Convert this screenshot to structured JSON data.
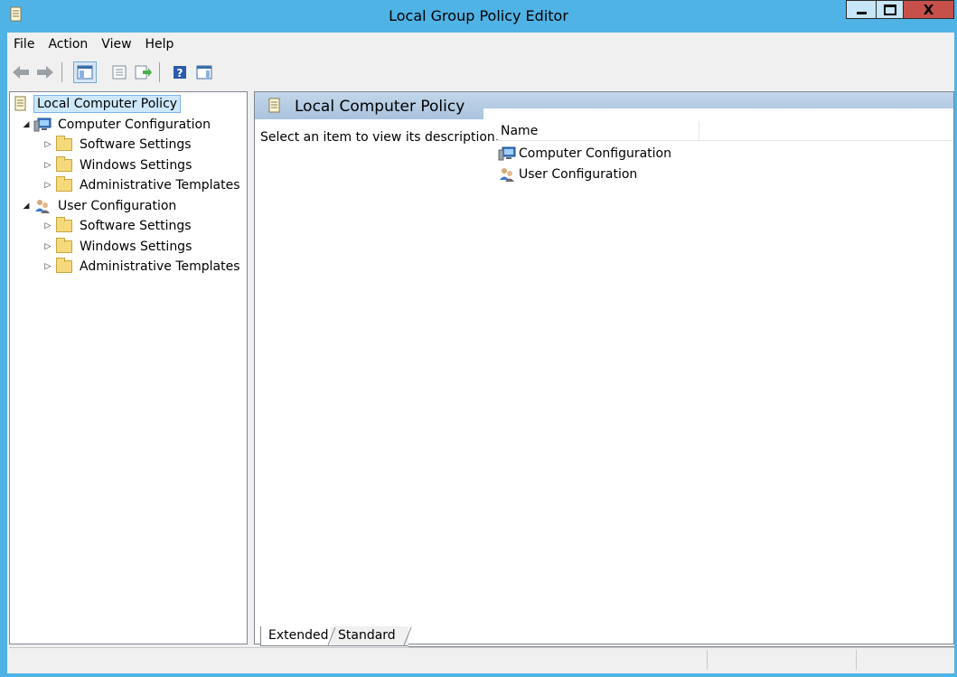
{
  "window": {
    "title": "Local Group Policy Editor",
    "accent_color": "#4fb3e6",
    "controls": {
      "minimize_icon": "minimize-icon",
      "maximize_icon": "maximize-icon",
      "close_label": "X"
    }
  },
  "menubar": {
    "items": [
      "File",
      "Action",
      "View",
      "Help"
    ]
  },
  "toolbar": {
    "buttons": [
      {
        "name": "back",
        "icon": "back-arrow-icon"
      },
      {
        "name": "forward",
        "icon": "forward-arrow-icon"
      },
      {
        "name": "show-hide-console-tree",
        "icon": "console-tree-icon",
        "pressed": true
      },
      {
        "name": "properties",
        "icon": "properties-icon"
      },
      {
        "name": "export-list",
        "icon": "export-list-icon"
      },
      {
        "name": "help",
        "icon": "help-icon"
      },
      {
        "name": "show-hide-action-pane",
        "icon": "action-pane-icon"
      }
    ]
  },
  "tree": {
    "root": "Local Computer Policy",
    "items": [
      {
        "label": "Computer Configuration",
        "expanded": true,
        "icon": "computer-icon"
      },
      {
        "label": "Software Settings",
        "icon": "folder-icon"
      },
      {
        "label": "Windows Settings",
        "icon": "folder-icon"
      },
      {
        "label": "Administrative Templates",
        "icon": "folder-icon"
      },
      {
        "label": "User Configuration",
        "expanded": true,
        "icon": "users-icon"
      },
      {
        "label": "Software Settings",
        "icon": "folder-icon"
      },
      {
        "label": "Windows Settings",
        "icon": "folder-icon"
      },
      {
        "label": "Administrative Templates",
        "icon": "folder-icon"
      }
    ]
  },
  "content": {
    "header_title": "Local Computer Policy",
    "description": "Select an item to view its description.",
    "column_name": "Name",
    "rows": [
      {
        "label": "Computer Configuration",
        "icon": "computer-icon"
      },
      {
        "label": "User Configuration",
        "icon": "users-icon"
      }
    ]
  },
  "tabs": {
    "extended": "Extended",
    "standard": "Standard",
    "active": "Extended"
  }
}
